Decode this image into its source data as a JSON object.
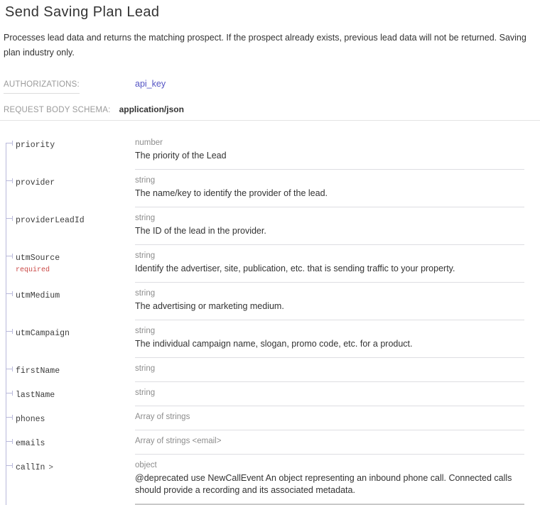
{
  "page": {
    "title": "Send Saving Plan Lead",
    "description": "Processes lead data and returns the matching prospect. If the prospect already exists, previous lead data will not be returned. Saving plan industry only."
  },
  "authorizations": {
    "label": "AUTHORIZATIONS:",
    "value": "api_key"
  },
  "request_body": {
    "label": "REQUEST BODY SCHEMA:",
    "value": "application/json"
  },
  "colors": {
    "link": "#5454c4",
    "required": "#cb4a47",
    "tree": "#b9b9da",
    "separator": "#dedee2"
  },
  "fields": [
    {
      "name": "priority",
      "type": "number",
      "description": "The priority of the Lead"
    },
    {
      "name": "provider",
      "type": "string",
      "description": "The name/key to identify the provider of the lead."
    },
    {
      "name": "providerLeadId",
      "type": "string",
      "description": "The ID of the lead in the provider."
    },
    {
      "name": "utmSource",
      "required_label": "required",
      "type": "string",
      "description": "Identify the advertiser, site, publication, etc. that is sending traffic to your property."
    },
    {
      "name": "utmMedium",
      "type": "string",
      "description": "The advertising or marketing medium."
    },
    {
      "name": "utmCampaign",
      "type": "string",
      "description": "The individual campaign name, slogan, promo code, etc. for a product."
    },
    {
      "name": "firstName",
      "type": "string"
    },
    {
      "name": "lastName",
      "type": "string"
    },
    {
      "name": "phones",
      "type": "Array of strings"
    },
    {
      "name": "emails",
      "type": "Array of strings <email>"
    },
    {
      "name": "callIn",
      "expand_arrow": ">",
      "type": "object",
      "description": "@deprecated use NewCallEvent An object representing an inbound phone call. Connected calls should provide a recording and its associated metadata."
    }
  ]
}
